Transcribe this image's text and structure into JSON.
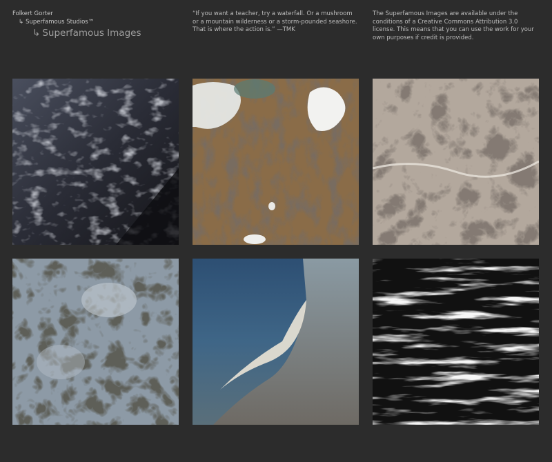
{
  "header": {
    "breadcrumb": [
      {
        "label": "Folkert Gorter"
      },
      {
        "label": "Superfamous Studios™",
        "arrow": "↳"
      },
      {
        "label": "Superfamous Images",
        "arrow": "↳"
      }
    ],
    "quote": "“If you want a teacher, try a waterfall. Or a mushroom or a mountain wilderness or a storm-pounded seashore. That is where the action is.” —TMK",
    "license": "The Superfamous Images are available under the conditions of a Creative Commons Attribution 3.0 license. This means that you can use the work for your own purposes if credit is provided."
  },
  "gallery": {
    "columns": 3,
    "rows": 2,
    "images": [
      {
        "subject": "dark rippled water surface"
      },
      {
        "subject": "aerial view of brown terrain with snow patches and ponds"
      },
      {
        "subject": "cracked pale rock surface"
      },
      {
        "subject": "blue-grey fractured rock"
      },
      {
        "subject": "aerial view of blue shoreline and sand flats"
      },
      {
        "subject": "black and white rushing water"
      }
    ]
  },
  "colors": {
    "background": "#2c2c2c",
    "text": "#bdbdbd",
    "title_muted": "#9e9e9e"
  }
}
